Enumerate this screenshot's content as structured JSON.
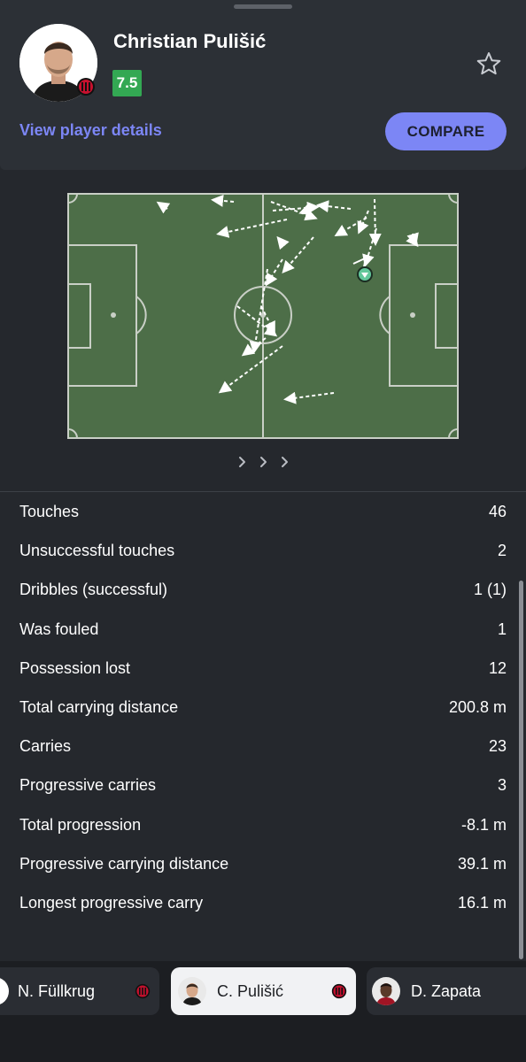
{
  "player": {
    "name": "Christian Pulišić",
    "rating": "7.5",
    "details_link": "View player details",
    "compare_label": "COMPARE"
  },
  "pager": {
    "icon": "chevron-right-icon"
  },
  "stats": [
    {
      "label": "Touches",
      "value": "46"
    },
    {
      "label": "Unsuccessful touches",
      "value": "2"
    },
    {
      "label": "Dribbles (successful)",
      "value": "1 (1)"
    },
    {
      "label": "Was fouled",
      "value": "1"
    },
    {
      "label": "Possession lost",
      "value": "12"
    },
    {
      "label": "Total carrying distance",
      "value": "200.8 m"
    },
    {
      "label": "Carries",
      "value": "23"
    },
    {
      "label": "Progressive carries",
      "value": "3"
    },
    {
      "label": "Total progression",
      "value": "-8.1 m"
    },
    {
      "label": "Progressive carrying distance",
      "value": "39.1 m"
    },
    {
      "label": "Longest progressive carry",
      "value": "16.1 m"
    }
  ],
  "player_switcher": [
    {
      "name": "N. Füllkrug",
      "active": false
    },
    {
      "name": "C. Pulišić",
      "active": true
    },
    {
      "name": "D. Zapata",
      "active": false
    }
  ],
  "colors": {
    "background": "#25282d",
    "card": "#2c3036",
    "accent": "#7c86f5",
    "rating_green": "#33a853",
    "pitch_green": "#4d6e48"
  }
}
